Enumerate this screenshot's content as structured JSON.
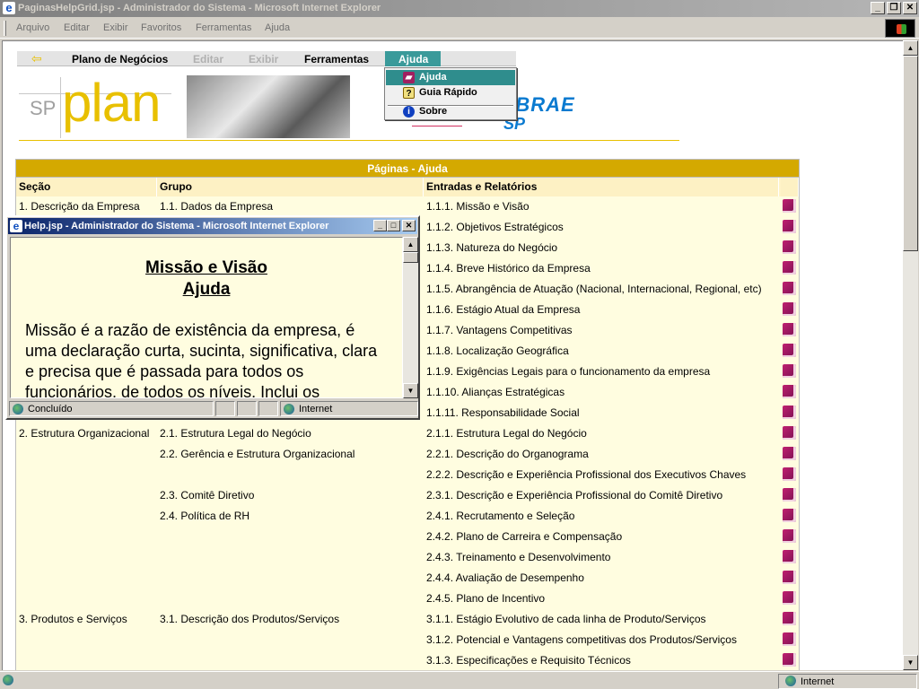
{
  "window": {
    "title": "PaginasHelpGrid.jsp - Administrador do Sistema - Microsoft Internet Explorer",
    "menus": [
      "Arquivo",
      "Editar",
      "Exibir",
      "Favoritos",
      "Ferramentas",
      "Ajuda"
    ],
    "status_zone": "Internet"
  },
  "nav": {
    "items": [
      "Plano de Negócios",
      "Editar",
      "Exibir",
      "Ferramentas",
      "Ajuda"
    ],
    "dropdown": [
      "Ajuda",
      "Guia Rápido",
      "Sobre"
    ]
  },
  "banner": {
    "sp": "SP",
    "plan": "plan",
    "sebrae": "SEBRAE",
    "sebrae_sp": "SP"
  },
  "table": {
    "title": "Páginas - Ajuda",
    "headers": [
      "Seção",
      "Grupo",
      "Entradas e Relatórios"
    ],
    "rows": [
      [
        "1. Descrição da Empresa",
        "1.1. Dados da Empresa",
        "1.1.1. Missão e Visão"
      ],
      [
        "",
        "",
        "1.1.2. Objetivos Estratégicos"
      ],
      [
        "",
        "",
        "1.1.3. Natureza do Negócio"
      ],
      [
        "",
        "",
        "1.1.4. Breve Histórico da Empresa"
      ],
      [
        "",
        "",
        "1.1.5. Abrangência de Atuação (Nacional, Internacional, Regional, etc)"
      ],
      [
        "",
        "",
        "1.1.6. Estágio Atual da Empresa"
      ],
      [
        "",
        "",
        "1.1.7. Vantagens Competitivas"
      ],
      [
        "",
        "",
        "1.1.8. Localização Geográfica"
      ],
      [
        "",
        "",
        "1.1.9. Exigências Legais para o funcionamento da empresa"
      ],
      [
        "",
        "",
        "1.1.10. Alianças Estratégicas"
      ],
      [
        "",
        "",
        "1.1.11. Responsabilidade Social"
      ],
      [
        "2. Estrutura Organizacional",
        "2.1. Estrutura Legal do Negócio",
        "2.1.1. Estrutura Legal do Negócio"
      ],
      [
        "",
        "2.2. Gerência e Estrutura Organizacional",
        "2.2.1. Descrição do Organograma"
      ],
      [
        "",
        "",
        "2.2.2. Descrição e Experiência Profissional dos Executivos Chaves"
      ],
      [
        "",
        "2.3. Comitê Diretivo",
        "2.3.1. Descrição e Experiência Profissional do Comitê Diretivo"
      ],
      [
        "",
        "2.4. Política de RH",
        "2.4.1. Recrutamento e Seleção"
      ],
      [
        "",
        "",
        "2.4.2. Plano de Carreira e Compensação"
      ],
      [
        "",
        "",
        "2.4.3. Treinamento e Desenvolvimento"
      ],
      [
        "",
        "",
        "2.4.4. Avaliação de Desempenho"
      ],
      [
        "",
        "",
        "2.4.5. Plano de Incentivo"
      ],
      [
        "3. Produtos e Serviços",
        "3.1. Descrição dos Produtos/Serviços",
        "3.1.1. Estágio Evolutivo de cada linha de Produto/Serviços"
      ],
      [
        "",
        "",
        "3.1.2. Potencial e Vantagens competitivas dos Produtos/Serviços"
      ],
      [
        "",
        "",
        "3.1.3. Especificações e Requisito Técnicos"
      ]
    ]
  },
  "popup": {
    "title": "Help.jsp - Administrador do Sistema - Microsoft Internet Explorer",
    "heading1": "Missão e Visão",
    "heading2": "Ajuda",
    "text": "Missão é a razão de existência da empresa, é uma declaração curta, sucinta, significativa, clara e precisa que é passada para todos os funcionários, de todos os níveis. Inclui os",
    "status": "Concluído",
    "zone": "Internet"
  }
}
